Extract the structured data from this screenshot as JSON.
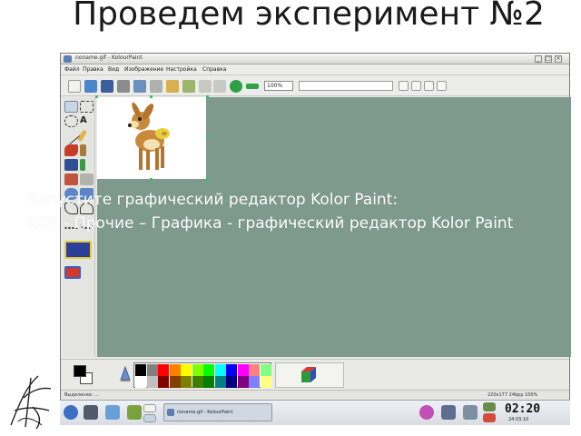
{
  "slide": {
    "title": "Проведем эксперимент №2",
    "overlay_line1": "Запустите графический редактор Kolor Paint:",
    "overlay_line2": "KDE - Прочие – Графика - графический редактор Kolor Paint"
  },
  "window": {
    "title": "noname.gif - KolourPaint",
    "menu": [
      "Файл",
      "Правка",
      "Вид",
      "Изображение",
      "Настройка",
      "Справка"
    ],
    "zoom_value": "100%",
    "status_left": "Выделение: ...",
    "status_right": "220x177  24bpp  100%"
  },
  "palette": {
    "foreground": "#000000",
    "background": "#ffffff",
    "row1": [
      "#000000",
      "#808080",
      "#ff0000",
      "#ff8000",
      "#ffff00",
      "#80ff00",
      "#00ff00",
      "#00ffff",
      "#0000ff",
      "#ff00ff",
      "#ff8080",
      "#80ff80"
    ],
    "row2": [
      "#ffffff",
      "#c0c0c0",
      "#800000",
      "#804000",
      "#808000",
      "#408000",
      "#008000",
      "#008080",
      "#000080",
      "#800080",
      "#8080ff",
      "#ffff80"
    ]
  },
  "taskbar": {
    "task_label": "noname.gif - KolourPaint",
    "clock_time": "02:20",
    "clock_date": "24.03.10"
  },
  "icons": [
    "app-icon",
    "new-icon",
    "open-icon",
    "save-icon",
    "print-icon",
    "undo-icon",
    "redo-icon",
    "zoom-in-icon",
    "zoom-out-icon",
    "selection-icon",
    "pencil-icon",
    "brush-icon",
    "fill-icon",
    "eraser-icon",
    "text-icon",
    "line-icon",
    "rectangle-icon",
    "ellipse-icon",
    "color-picker-icon",
    "rgb-cube-icon",
    "kde-menu-icon",
    "terminal-icon",
    "files-icon",
    "cd-icon",
    "network-icon",
    "logo-monogram"
  ]
}
